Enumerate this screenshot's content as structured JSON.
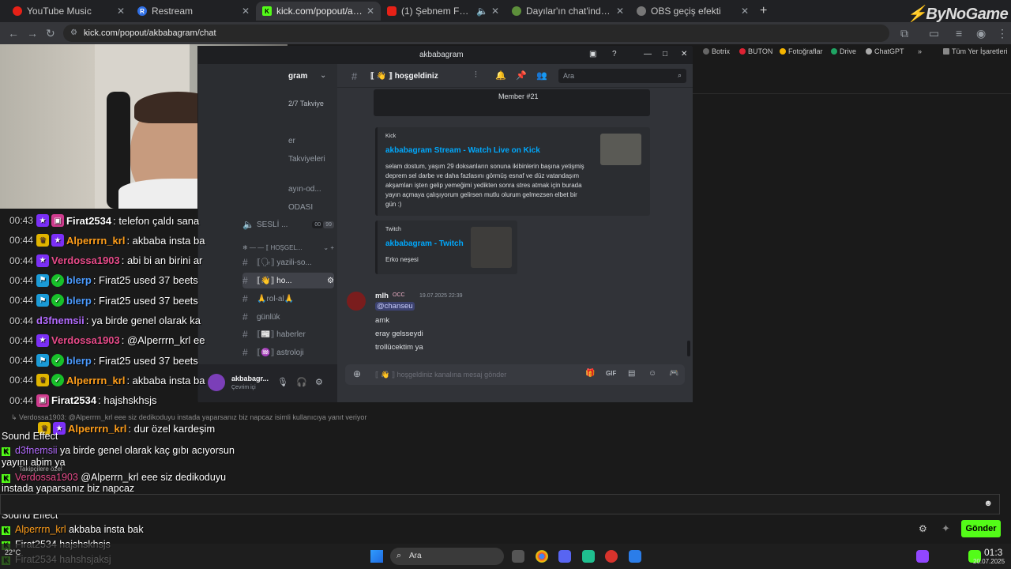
{
  "browser": {
    "tabs": [
      {
        "label": "YouTube Music",
        "color": "#e62117",
        "letter": ""
      },
      {
        "label": "Restream",
        "color": "#2f6fe5",
        "letter": "R"
      },
      {
        "label": "kick.com/popout/akbabagram/",
        "color": "#53fc18",
        "letter": "K"
      },
      {
        "label": "(1) Şebnem Ferah - Çakıl Ta",
        "color": "#e62117",
        "letter": ""
      },
      {
        "label": "Dayılar'ın chat'indeki en iyi nick",
        "color": "#5d8f3b",
        "letter": ""
      },
      {
        "label": "OBS geçiş efekti",
        "color": "#777777",
        "letter": ""
      }
    ],
    "new_tab": "+",
    "brand_logo": "ByNoGame",
    "url": "kick.com/popout/akbabagram/chat",
    "bookmarks": [
      "Botrix",
      "BUTON",
      "Fotoğraflar",
      "Drive",
      "ChatGPT",
      "»",
      "Tüm Yer İşaretleri"
    ]
  },
  "discord": {
    "window_title": "akbabagram",
    "server_name": "gram",
    "boost_label": "2/7 Takviye",
    "sidebar_fragments": [
      "er",
      "Takviyeleri",
      "ayın-od...",
      "ODASI"
    ],
    "voice_channel": "SESLİ ...",
    "voice_counts": [
      "00",
      "99"
    ],
    "category": "❄ — — ⟦ HOŞGEL...",
    "channels": [
      {
        "name": "⟦🗣⟧ yazili-so...",
        "active": false
      },
      {
        "name": "⟦👋⟧ ho...",
        "active": true
      },
      {
        "name": "🙏rol-al🙏",
        "active": false
      },
      {
        "name": "günlük",
        "active": false
      },
      {
        "name": "⟦📰⟧ haberler",
        "active": false
      },
      {
        "name": "⟦♒⟧ astroloji",
        "active": false
      }
    ],
    "user": {
      "name": "akbabagr...",
      "status": "Çevrim içi"
    },
    "channel_header": "⟦ 👋 ⟧ hoşgeldiniz",
    "search_placeholder": "Ara",
    "member_label": "Member #21",
    "kick_embed": {
      "provider": "Kick",
      "title": "akbabagram Stream - Watch Live on Kick",
      "desc": "selam dostum, yaşım 29 doksanların sonuna ikibinlerin başına yetişmiş deprem sel darbe ve daha fazlasını görmüş esnaf ve düz vatandaşım akşamları işten gelip yemeğimi yedikten sonra stres atmak için burada yayın açmaya çalışıyorum gelirsen mutlu olurum gelmezsen elbet bir gün :)"
    },
    "twitch_embed": {
      "provider": "Twitch",
      "title": "akbabagram - Twitch",
      "desc": "Erko neşesi"
    },
    "message": {
      "author": "mlh",
      "tag": "OCC",
      "timestamp": "19.07.2025 22:39",
      "mention": "@chanseu",
      "lines": [
        "amk",
        "eray gelsseydi",
        "trollücektim ya"
      ]
    },
    "composer_placeholder": "⟦ 👋 ⟧ hoşgeldiniz kanalına mesaj gönder"
  },
  "stream_chat": [
    {
      "time": "00:43",
      "badges": [
        "star",
        "gift"
      ],
      "user": "Firat2534",
      "color": "#ffffff",
      "text": ": telefon çaldı sana"
    },
    {
      "time": "00:44",
      "badges": [
        "crown",
        "star"
      ],
      "user": "Alperrrn_krl",
      "color": "#ff9e1b",
      "text": ": akbaba insta ba"
    },
    {
      "time": "00:44",
      "badges": [
        "star"
      ],
      "user": "Verdossa1903",
      "color": "#e94b8a",
      "text": ": abi bi an birini ar"
    },
    {
      "time": "00:44",
      "badges": [
        "mod",
        "ver"
      ],
      "user": "blerp",
      "color": "#4b9bff",
      "text": ": Firat25 used 37 beets"
    },
    {
      "time": "00:44",
      "badges": [
        "mod",
        "ver"
      ],
      "user": "blerp",
      "color": "#4b9bff",
      "text": ": Firat25 used 37 beets"
    },
    {
      "time": "00:44",
      "badges": [],
      "user": "d3fnemsii",
      "color": "#b36bff",
      "text": ": ya birde genel olarak ka"
    },
    {
      "time": "00:44",
      "badges": [
        "star"
      ],
      "user": "Verdossa1903",
      "color": "#e94b8a",
      "text": ": @Alperrrn_krl ee"
    },
    {
      "time": "00:44",
      "badges": [
        "mod",
        "ver"
      ],
      "user": "blerp",
      "color": "#4b9bff",
      "text": ": Firat25 used 37 beets"
    },
    {
      "time": "00:44",
      "badges": [
        "crown",
        "ver"
      ],
      "user": "Alperrrn_krl",
      "color": "#ff9e1b",
      "text": ": akbaba insta ba"
    },
    {
      "time": "00:44",
      "badges": [
        "gift"
      ],
      "user": "Firat2534",
      "color": "#ffffff",
      "text": ": hajshskhsjs"
    }
  ],
  "reply_note": "↳ Verdossa1903: @Alperrrn_krl eee siz dedikoduyu instada yaparsanız biz napcaz isimli kullanıcıya yanıt veriyor",
  "reply_row": {
    "user": "Alperrrn_krl",
    "text": ": dur özel kardeşim"
  },
  "kick_overlay": [
    {
      "user": "Sound Effect",
      "color": "#ffffff",
      "text": "",
      "logo": false
    },
    {
      "user": "d3fnemsii",
      "color": "#b36bff",
      "text": " ya birde genel olarak kaç gıbı acıyorsun",
      "logo": true
    },
    {
      "user": "",
      "color": "#ffffff",
      "text": "yayını abim ya",
      "logo": false
    },
    {
      "user": "Verdossa1903",
      "color": "#e94b8a",
      "text": " @Alperrn_krl eee siz dedikoduyu",
      "logo": true
    },
    {
      "user": "",
      "color": "#ffffff",
      "text": "instada yaparsanız biz napcaz",
      "logo": false
    },
    {
      "user": "blerp",
      "color": "#4b9bff",
      "text": " Firat25 used 37 beets to play Discord Join",
      "logo": true
    },
    {
      "user": "",
      "color": "#ffffff",
      "text": "Sound Effect",
      "logo": false
    },
    {
      "user": "Alperrrn_krl",
      "color": "#ff9e1b",
      "text": " akbaba insta bak",
      "logo": true
    },
    {
      "user": "Firat2534",
      "color": "#ffffff",
      "text": " hajshskhsjs",
      "logo": true
    },
    {
      "user": "Firat2534",
      "color": "#ffffff",
      "text": " hahshsjaksj",
      "logo": true
    }
  ],
  "followers_label": "Takipçilere özel",
  "send_button": "Gönder",
  "taskbar": {
    "search": "Ara",
    "weather": "22°C",
    "clock": "01:3",
    "date": "20.07.2025"
  }
}
